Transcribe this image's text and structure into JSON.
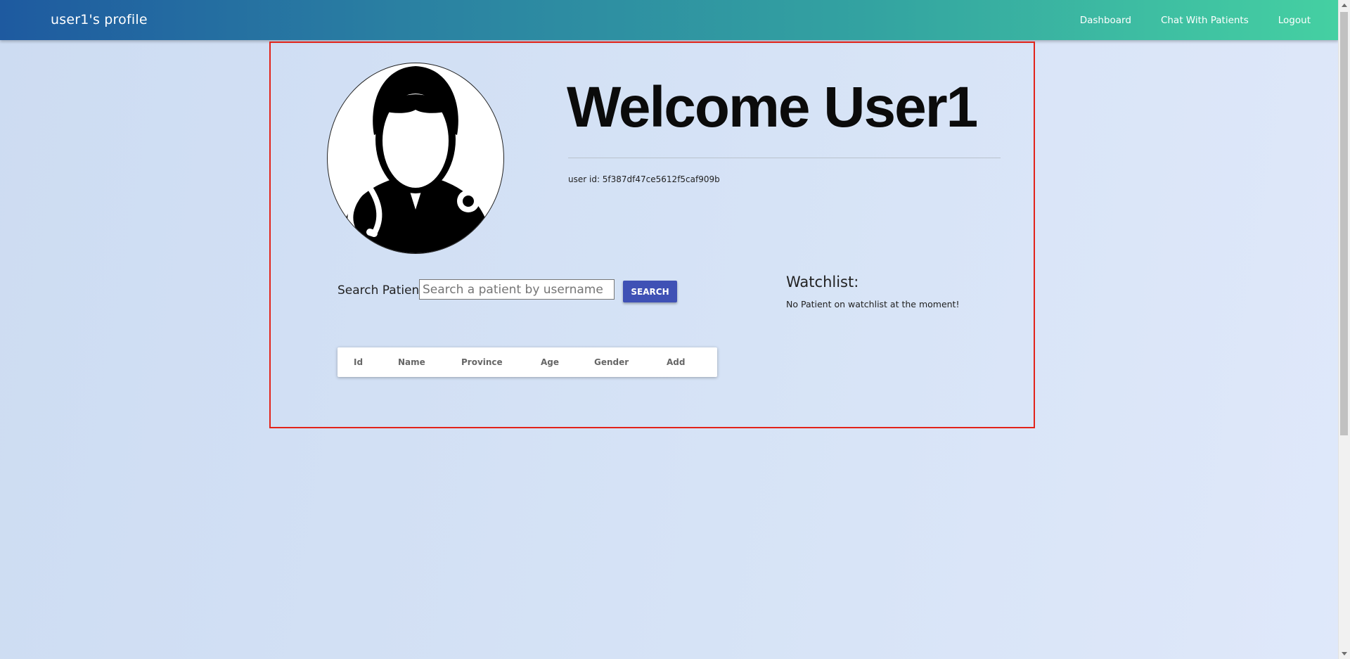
{
  "navbar": {
    "brand": "user1's profile",
    "links": [
      "Dashboard",
      "Chat With Patients",
      "Logout"
    ],
    "gradient_start": "#1e5aa0",
    "gradient_end": "#45d0a2"
  },
  "profile": {
    "avatar_icon": "doctor-with-stethoscope-icon",
    "welcome": "Welcome User1",
    "user_id": "user id: 5f387df47ce5612f5caf909b"
  },
  "search": {
    "label": "Search Patient:",
    "placeholder": "Search a patient by username",
    "value": "",
    "button_label": "SEARCH",
    "button_color": "#3f51b5"
  },
  "watchlist": {
    "title": "Watchlist:",
    "empty_message": "No Patient on watchlist at the moment!"
  },
  "table": {
    "columns": [
      "Id",
      "Name",
      "Province",
      "Age",
      "Gender",
      "Add"
    ],
    "rows": []
  },
  "frame_color": "#e2231a"
}
